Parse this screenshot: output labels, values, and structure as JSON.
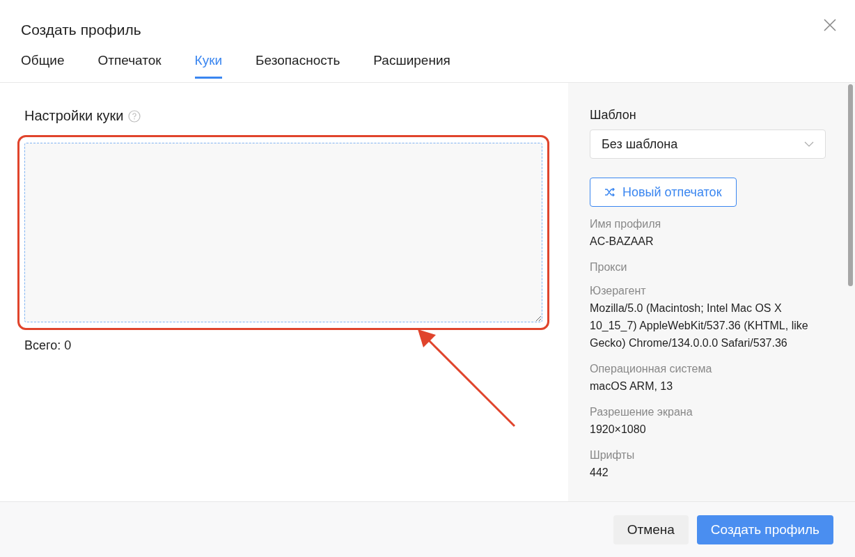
{
  "dialog": {
    "title": "Создать профиль"
  },
  "tabs": [
    {
      "label": "Общие",
      "selected": false
    },
    {
      "label": "Отпечаток",
      "selected": false
    },
    {
      "label": "Куки",
      "selected": true
    },
    {
      "label": "Безопасность",
      "selected": false
    },
    {
      "label": "Расширения",
      "selected": false
    }
  ],
  "cookies": {
    "heading": "Настройки куки",
    "total": "Всего: 0"
  },
  "sidebar": {
    "template_label": "Шаблон",
    "template_value": "Без шаблона",
    "new_fingerprint_button": "Новый отпечаток",
    "fields": [
      {
        "label": "Имя профиля",
        "value": "AC-BAZAAR"
      },
      {
        "label": "Прокси"
      },
      {
        "label": "Юзерагент",
        "value": "Mozilla/5.0 (Macintosh; Intel Mac OS X 10_15_7) AppleWebKit/537.36 (KHTML, like Gecko) Chrome/134.0.0.0 Safari/537.36"
      },
      {
        "label": "Операционная система",
        "value": "macOS ARM, 13"
      },
      {
        "label": "Разрешение экрана",
        "value": "1920×1080"
      },
      {
        "label": "Шрифты",
        "value": "442"
      }
    ]
  },
  "footer": {
    "buttons": [
      "Отмена",
      "Создать профиль"
    ]
  }
}
